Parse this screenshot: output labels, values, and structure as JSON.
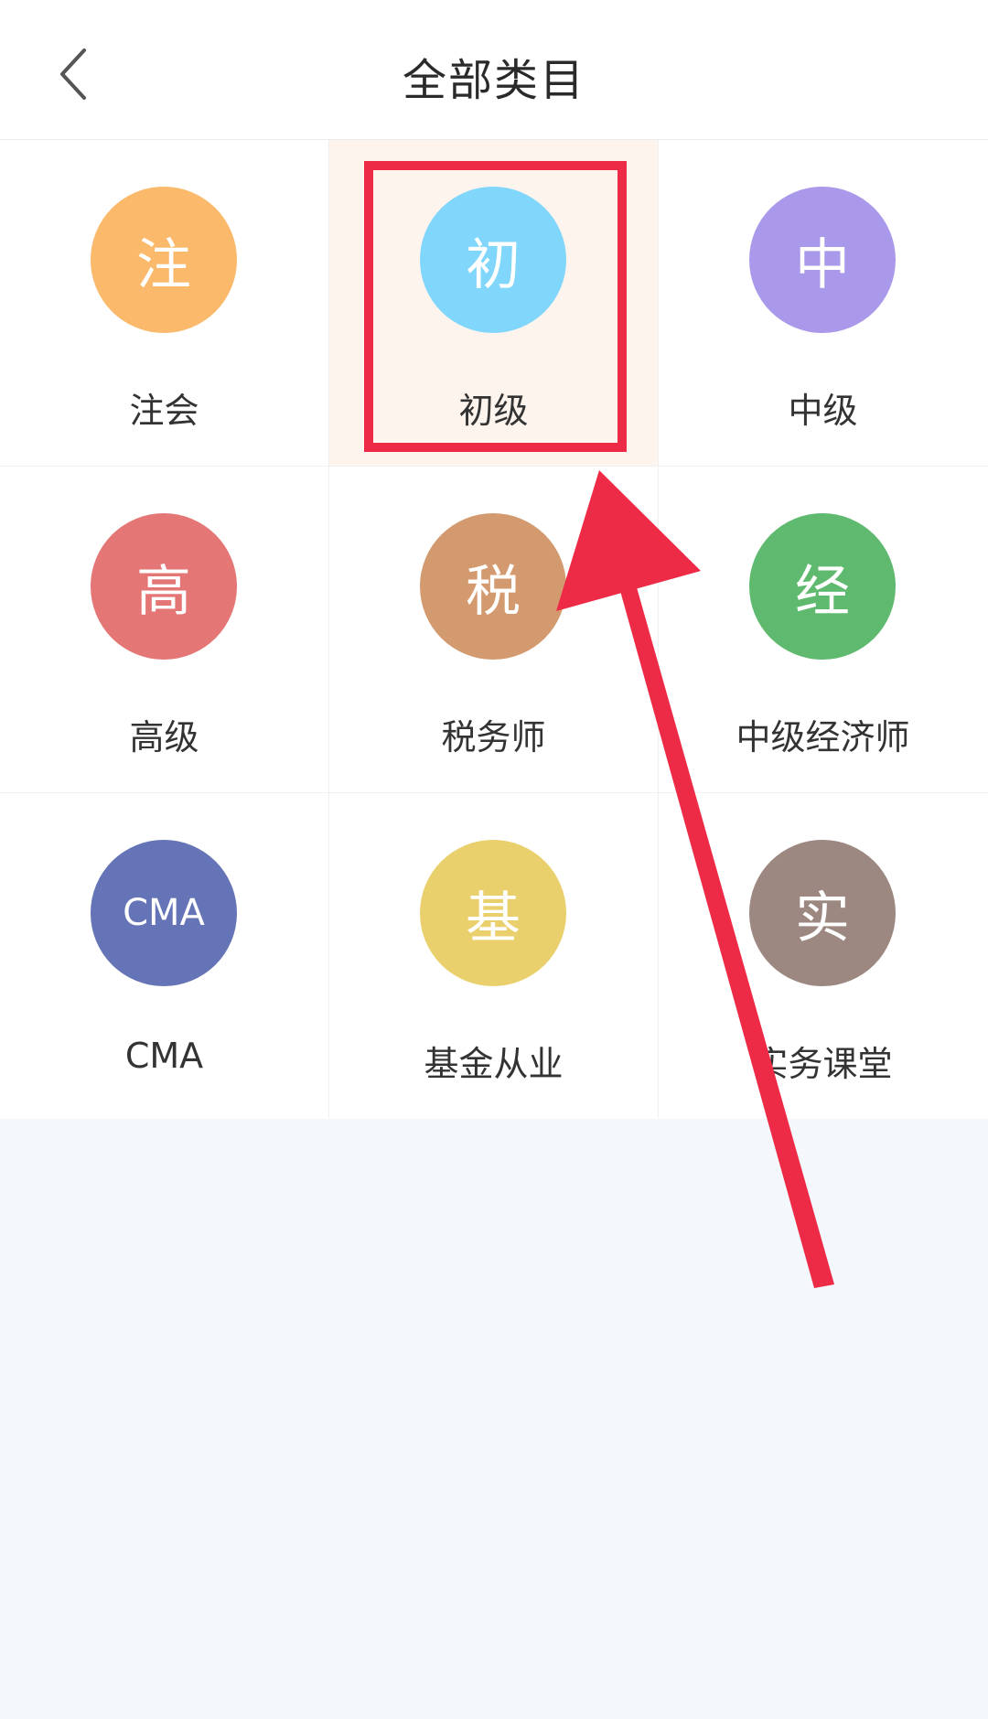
{
  "header": {
    "title": "全部类目",
    "back_icon": "chevron-left-icon"
  },
  "categories": [
    {
      "id": "zhuhui",
      "label": "注会",
      "icon_text": "注",
      "color": "#fbb96b",
      "selected": false
    },
    {
      "id": "chuji",
      "label": "初级",
      "icon_text": "初",
      "color": "#80d6fb",
      "selected": true
    },
    {
      "id": "zhongji",
      "label": "中级",
      "icon_text": "中",
      "color": "#aa99ea",
      "selected": false
    },
    {
      "id": "gaoji",
      "label": "高级",
      "icon_text": "高",
      "color": "#e47676",
      "selected": false
    },
    {
      "id": "shuiwushi",
      "label": "税务师",
      "icon_text": "税",
      "color": "#d49a6f",
      "selected": false
    },
    {
      "id": "jingjishi",
      "label": "中级经济师",
      "icon_text": "经",
      "color": "#5fba6f",
      "selected": false
    },
    {
      "id": "cma",
      "label": "CMA",
      "icon_text": "CMA",
      "color": "#6474b6",
      "selected": false
    },
    {
      "id": "jijin",
      "label": "基金从业",
      "icon_text": "基",
      "color": "#ead06c",
      "selected": false
    },
    {
      "id": "shiwu",
      "label": "实务课堂",
      "icon_text": "实",
      "color": "#9c8880",
      "selected": false
    }
  ],
  "annotation": {
    "color": "#ee2b47",
    "highlight_target": "初级"
  }
}
